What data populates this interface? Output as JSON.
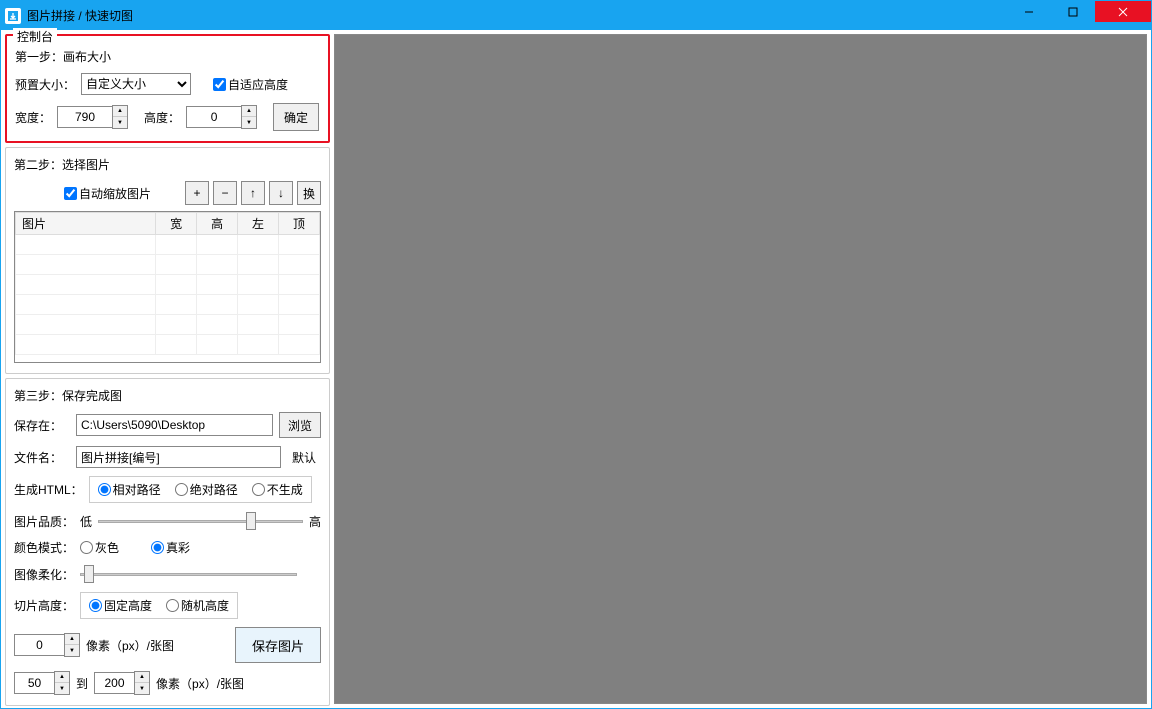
{
  "title": "图片拼接 / 快速切图",
  "panel_title": "控制台",
  "step1": {
    "label": "第一步：画布大小",
    "preset_label": "预置大小：",
    "preset_value": "自定义大小",
    "adaptive_label": "自适应高度",
    "adaptive_checked": true,
    "width_label": "宽度：",
    "width_value": "790",
    "height_label": "高度：",
    "height_value": "0",
    "confirm": "确定"
  },
  "step2": {
    "label": "第二步：选择图片",
    "autoscale_label": "自动缩放图片",
    "autoscale_checked": true,
    "btn_add": "+",
    "btn_remove": "−",
    "btn_up": "↑",
    "btn_down": "↓",
    "btn_swap": "换",
    "columns": [
      "图片",
      "宽",
      "高",
      "左",
      "顶"
    ]
  },
  "step3": {
    "label": "第三步：保存完成图",
    "save_to_label": "保存在：",
    "save_to_value": "C:\\Users\\5090\\Desktop",
    "browse": "浏览",
    "filename_label": "文件名：",
    "filename_value": "图片拼接[编号]",
    "default": "默认",
    "gen_html_label": "生成HTML：",
    "radio_rel": "相对路径",
    "radio_abs": "绝对路径",
    "radio_none": "不生成",
    "quality_label": "图片品质：",
    "quality_low": "低",
    "quality_high": "高",
    "color_label": "颜色模式：",
    "color_gray": "灰色",
    "color_true": "真彩",
    "soften_label": "图像柔化：",
    "slice_label": "切片高度：",
    "slice_fixed": "固定高度",
    "slice_random": "随机高度",
    "fixed_value": "0",
    "pixels_per": "像素（px）/张图",
    "save_btn": "保存图片",
    "rand_from": "50",
    "to": "到",
    "rand_to": "200"
  }
}
